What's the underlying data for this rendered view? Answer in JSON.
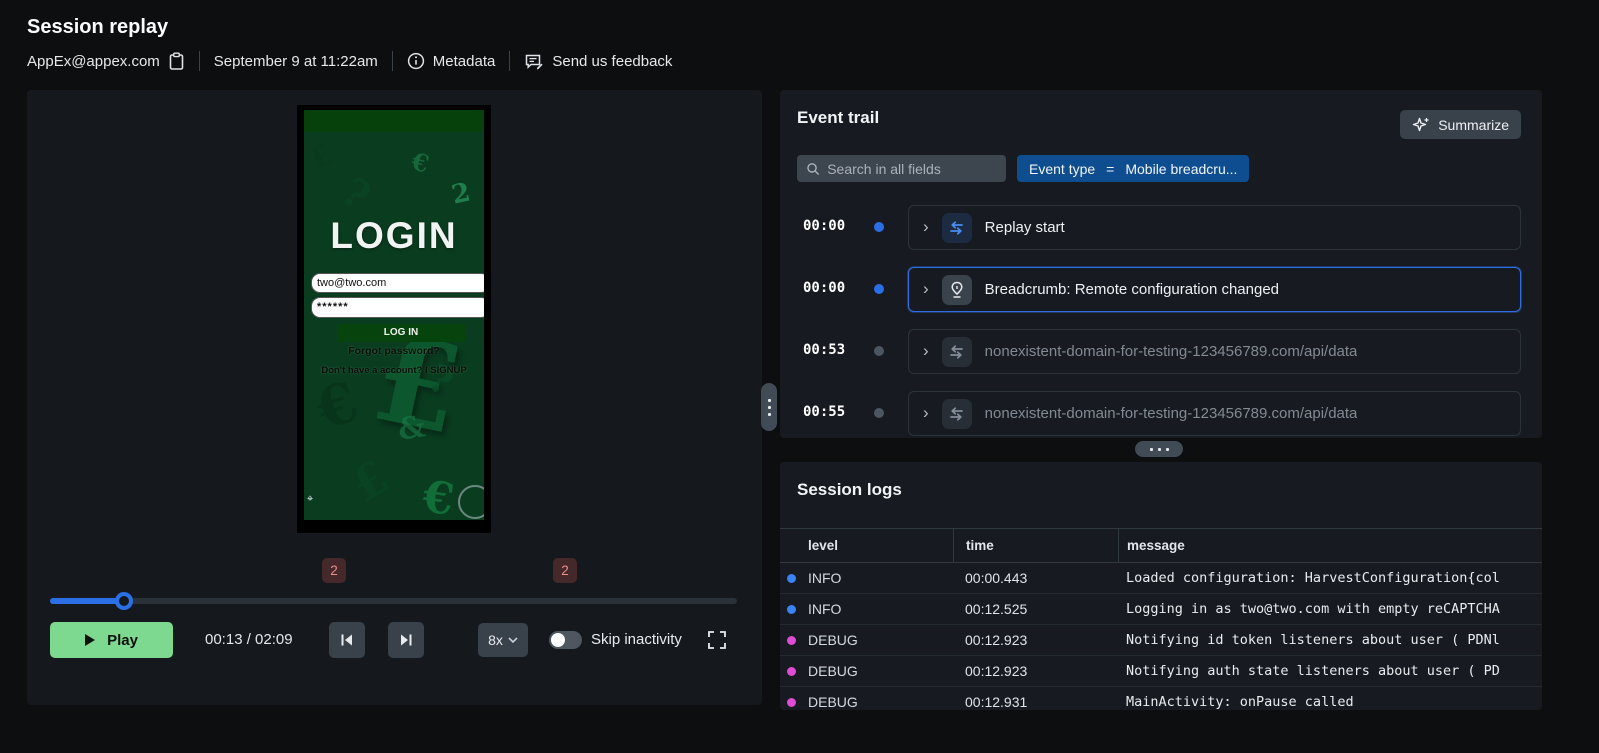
{
  "header": {
    "title": "Session replay",
    "user_email": "AppEx@appex.com",
    "timestamp": "September 9 at 11:22am",
    "metadata_label": "Metadata",
    "feedback_label": "Send us feedback"
  },
  "replay": {
    "phone": {
      "login_title": "LOGIN",
      "email_value": "two@two.com",
      "password_value": "******",
      "login_button_label": "LOG IN",
      "forgot_password_label": "Forgot password?",
      "signup_label": "Don't have a account? I SIGNUP",
      "texture_glyphs": [
        "£",
        "€",
        "?",
        "2",
        "¥",
        "£",
        "€",
        "?",
        "&",
        "2",
        "£",
        "€"
      ]
    },
    "timeline": {
      "badge_counts": [
        "2",
        "2"
      ],
      "progress_width": "10.7%"
    },
    "controls": {
      "play_label": "Play",
      "time_display": "00:13 / 02:09",
      "speed_label": "8x",
      "skip_inactivity_label": "Skip inactivity"
    }
  },
  "event_trail": {
    "title": "Event trail",
    "summarize_label": "Summarize",
    "search_placeholder": "Search in all fields",
    "filter": {
      "field": "Event type",
      "operator": "=",
      "value": "Mobile breadcru..."
    },
    "events": [
      {
        "time": "00:00",
        "label": "Replay start",
        "icon": "replay-start-icon",
        "dot_color": "#2a6fe5"
      },
      {
        "time": "00:00",
        "label": "Breadcrumb: Remote configuration changed",
        "icon": "breadcrumb-pin-icon",
        "dot_color": "#2a6fe5"
      },
      {
        "time": "00:53",
        "label": "nonexistent-domain-for-testing-123456789.com/api/data",
        "icon": "network-request-icon",
        "dot_color": "#4c5660"
      },
      {
        "time": "00:55",
        "label": "nonexistent-domain-for-testing-123456789.com/api/data",
        "icon": "network-request-icon",
        "dot_color": "#4c5660"
      }
    ]
  },
  "session_logs": {
    "title": "Session logs",
    "columns": {
      "level": "level",
      "time": "time",
      "message": "message"
    },
    "rows": [
      {
        "level": "INFO",
        "time": "00:00.443",
        "message": "Loaded configuration: HarvestConfiguration{col",
        "dot_color": "#3b82f6"
      },
      {
        "level": "INFO",
        "time": "00:12.525",
        "message": "Logging in as two@two.com with empty reCAPTCHA",
        "dot_color": "#3b82f6"
      },
      {
        "level": "DEBUG",
        "time": "00:12.923",
        "message": "Notifying id token listeners about user ( PDNl",
        "dot_color": "#e14ad4"
      },
      {
        "level": "DEBUG",
        "time": "00:12.923",
        "message": "Notifying auth state listeners about user ( PD",
        "dot_color": "#e14ad4"
      },
      {
        "level": "DEBUG",
        "time": "00:12.931",
        "message": "MainActivity: onPause called",
        "dot_color": "#e14ad4"
      }
    ]
  }
}
